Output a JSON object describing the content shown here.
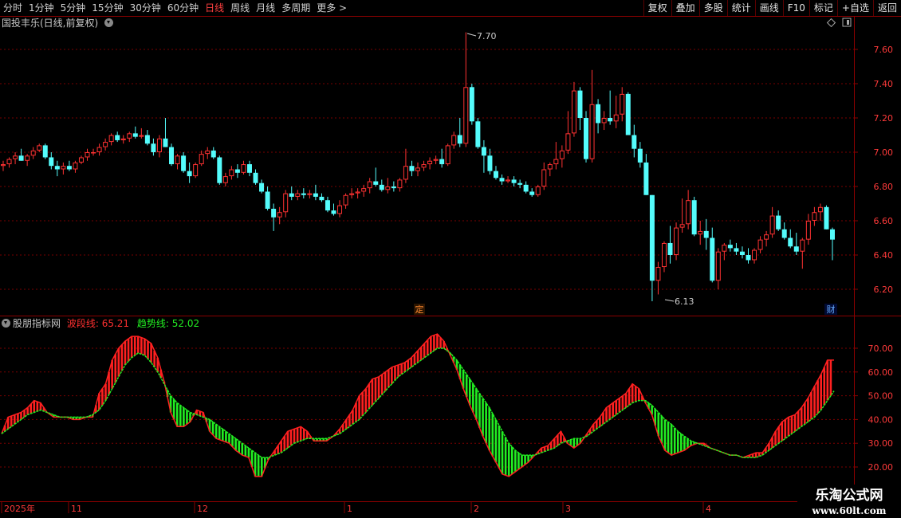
{
  "toolbar": {
    "periods": [
      {
        "label": "分时",
        "active": false
      },
      {
        "label": "1分钟",
        "active": false
      },
      {
        "label": "5分钟",
        "active": false
      },
      {
        "label": "15分钟",
        "active": false
      },
      {
        "label": "30分钟",
        "active": false
      },
      {
        "label": "60分钟",
        "active": false
      },
      {
        "label": "日线",
        "active": true
      },
      {
        "label": "周线",
        "active": false
      },
      {
        "label": "月线",
        "active": false
      },
      {
        "label": "多周期",
        "active": false
      },
      {
        "label": "更多 >",
        "active": false
      }
    ],
    "right_buttons": [
      "复权",
      "叠加",
      "多股",
      "统计",
      "画线",
      "F10",
      "标记",
      "+自选",
      "返回"
    ]
  },
  "main_panel": {
    "title": "国投丰乐(日线,前复权)",
    "high_label": "7.70",
    "low_label": "6.13",
    "y_ticks": [
      "7.60",
      "7.40",
      "7.20",
      "7.00",
      "6.80",
      "6.60",
      "6.40",
      "6.20"
    ],
    "marker_ding": "定",
    "marker_cai": "财"
  },
  "indicator_panel": {
    "name": "股朋指标网",
    "wave_label": "波段线: 65.21",
    "trend_label": "趋势线: 52.02",
    "y_ticks": [
      "70.00",
      "60.00",
      "50.00",
      "40.00",
      "30.00",
      "20.00"
    ]
  },
  "date_axis": {
    "labels": [
      "2025年",
      "11",
      "12",
      "1",
      "2",
      "3",
      "4"
    ]
  },
  "watermark": {
    "line1": "乐淘公式网",
    "line2": "www.60lt.com"
  },
  "colors": {
    "up": "#ff3232",
    "down": "#54fcfc",
    "wave": "#ff2020",
    "trend": "#22ee22",
    "grid": "#7a0000"
  },
  "chart_data": {
    "type": "candlestick",
    "price_range": [
      6.1,
      7.8
    ],
    "candles_ohlc": [
      [
        6.92,
        6.95,
        6.89,
        6.93
      ],
      [
        6.93,
        6.97,
        6.91,
        6.96
      ],
      [
        6.96,
        7.0,
        6.93,
        6.98
      ],
      [
        6.98,
        7.02,
        6.95,
        6.95
      ],
      [
        6.95,
        6.99,
        6.92,
        6.98
      ],
      [
        6.98,
        7.03,
        6.96,
        7.01
      ],
      [
        7.01,
        7.05,
        7.0,
        7.04
      ],
      [
        7.04,
        7.05,
        6.96,
        6.97
      ],
      [
        6.97,
        7.0,
        6.9,
        6.92
      ],
      [
        6.92,
        6.95,
        6.86,
        6.9
      ],
      [
        6.9,
        6.94,
        6.87,
        6.92
      ],
      [
        6.92,
        6.95,
        6.89,
        6.9
      ],
      [
        6.9,
        6.95,
        6.88,
        6.94
      ],
      [
        6.94,
        6.98,
        6.93,
        6.97
      ],
      [
        6.97,
        7.02,
        6.95,
        7.0
      ],
      [
        7.0,
        7.02,
        6.98,
        7.0
      ],
      [
        7.0,
        7.05,
        6.98,
        7.03
      ],
      [
        7.03,
        7.08,
        7.01,
        7.06
      ],
      [
        7.06,
        7.11,
        7.04,
        7.1
      ],
      [
        7.1,
        7.12,
        7.06,
        7.07
      ],
      [
        7.07,
        7.1,
        7.05,
        7.08
      ],
      [
        7.08,
        7.12,
        7.06,
        7.11
      ],
      [
        7.11,
        7.15,
        7.08,
        7.09
      ],
      [
        7.09,
        7.14,
        7.08,
        7.1
      ],
      [
        7.1,
        7.13,
        7.04,
        7.05
      ],
      [
        7.05,
        7.08,
        6.98,
        7.0
      ],
      [
        7.0,
        7.1,
        6.97,
        7.08
      ],
      [
        7.08,
        7.2,
        7.04,
        7.03
      ],
      [
        7.03,
        7.05,
        6.92,
        6.93
      ],
      [
        6.93,
        6.99,
        6.9,
        6.98
      ],
      [
        6.98,
        7.0,
        6.88,
        6.89
      ],
      [
        6.89,
        6.94,
        6.82,
        6.86
      ],
      [
        6.86,
        6.94,
        6.85,
        6.93
      ],
      [
        6.93,
        7.01,
        6.92,
        6.99
      ],
      [
        6.99,
        7.03,
        6.96,
        7.01
      ],
      [
        7.01,
        7.03,
        6.96,
        6.97
      ],
      [
        6.97,
        6.98,
        6.81,
        6.82
      ],
      [
        6.82,
        6.88,
        6.8,
        6.86
      ],
      [
        6.86,
        6.92,
        6.84,
        6.9
      ],
      [
        6.9,
        6.93,
        6.85,
        6.88
      ],
      [
        6.88,
        6.95,
        6.87,
        6.93
      ],
      [
        6.93,
        6.95,
        6.86,
        6.88
      ],
      [
        6.88,
        6.9,
        6.81,
        6.82
      ],
      [
        6.82,
        6.84,
        6.76,
        6.77
      ],
      [
        6.77,
        6.8,
        6.66,
        6.67
      ],
      [
        6.67,
        6.7,
        6.54,
        6.62
      ],
      [
        6.62,
        6.68,
        6.58,
        6.65
      ],
      [
        6.65,
        6.78,
        6.62,
        6.76
      ],
      [
        6.76,
        6.8,
        6.72,
        6.74
      ],
      [
        6.74,
        6.78,
        6.72,
        6.76
      ],
      [
        6.76,
        6.79,
        6.73,
        6.75
      ],
      [
        6.75,
        6.78,
        6.73,
        6.76
      ],
      [
        6.76,
        6.81,
        6.72,
        6.74
      ],
      [
        6.74,
        6.76,
        6.71,
        6.72
      ],
      [
        6.72,
        6.74,
        6.65,
        6.66
      ],
      [
        6.66,
        6.7,
        6.63,
        6.64
      ],
      [
        6.64,
        6.72,
        6.62,
        6.69
      ],
      [
        6.69,
        6.76,
        6.67,
        6.75
      ],
      [
        6.75,
        6.79,
        6.73,
        6.76
      ],
      [
        6.76,
        6.79,
        6.73,
        6.77
      ],
      [
        6.77,
        6.81,
        6.74,
        6.79
      ],
      [
        6.79,
        6.85,
        6.76,
        6.83
      ],
      [
        6.83,
        6.91,
        6.8,
        6.81
      ],
      [
        6.81,
        6.84,
        6.77,
        6.78
      ],
      [
        6.78,
        6.85,
        6.76,
        6.8
      ],
      [
        6.8,
        6.83,
        6.77,
        6.79
      ],
      [
        6.79,
        6.85,
        6.77,
        6.84
      ],
      [
        6.84,
        7.02,
        6.82,
        6.92
      ],
      [
        6.92,
        6.95,
        6.86,
        6.89
      ],
      [
        6.89,
        6.94,
        6.86,
        6.91
      ],
      [
        6.91,
        6.95,
        6.89,
        6.93
      ],
      [
        6.93,
        6.97,
        6.9,
        6.95
      ],
      [
        6.95,
        6.98,
        6.93,
        6.96
      ],
      [
        6.96,
        7.02,
        6.91,
        6.93
      ],
      [
        6.93,
        7.05,
        6.92,
        7.04
      ],
      [
        7.04,
        7.12,
        7.02,
        7.1
      ],
      [
        7.1,
        7.2,
        7.03,
        7.05
      ],
      [
        7.05,
        7.7,
        7.03,
        7.38
      ],
      [
        7.38,
        7.4,
        7.16,
        7.18
      ],
      [
        7.18,
        7.2,
        7.02,
        7.03
      ],
      [
        7.03,
        7.07,
        6.88,
        6.98
      ],
      [
        6.98,
        7.02,
        6.87,
        6.89
      ],
      [
        6.89,
        6.92,
        6.84,
        6.85
      ],
      [
        6.85,
        6.87,
        6.81,
        6.83
      ],
      [
        6.83,
        6.86,
        6.82,
        6.84
      ],
      [
        6.84,
        6.86,
        6.8,
        6.82
      ],
      [
        6.82,
        6.84,
        6.79,
        6.81
      ],
      [
        6.81,
        6.83,
        6.76,
        6.77
      ],
      [
        6.77,
        6.79,
        6.74,
        6.75
      ],
      [
        6.75,
        6.81,
        6.74,
        6.8
      ],
      [
        6.8,
        6.94,
        6.78,
        6.9
      ],
      [
        6.9,
        6.94,
        6.86,
        6.93
      ],
      [
        6.93,
        7.06,
        6.9,
        6.96
      ],
      [
        6.96,
        7.04,
        6.91,
        7.01
      ],
      [
        7.01,
        7.24,
        6.99,
        7.11
      ],
      [
        7.11,
        7.41,
        7.09,
        7.36
      ],
      [
        7.36,
        7.38,
        7.13,
        7.2
      ],
      [
        7.2,
        7.24,
        6.94,
        6.96
      ],
      [
        6.96,
        7.48,
        6.94,
        7.28
      ],
      [
        7.28,
        7.31,
        7.11,
        7.17
      ],
      [
        7.17,
        7.24,
        7.13,
        7.2
      ],
      [
        7.2,
        7.36,
        7.16,
        7.18
      ],
      [
        7.18,
        7.33,
        7.14,
        7.22
      ],
      [
        7.22,
        7.38,
        7.18,
        7.34
      ],
      [
        7.34,
        7.35,
        7.13,
        7.1
      ],
      [
        7.1,
        7.16,
        6.97,
        7.02
      ],
      [
        7.02,
        7.06,
        6.91,
        6.94
      ],
      [
        6.94,
        6.99,
        6.75,
        6.75
      ],
      [
        6.75,
        6.63,
        6.13,
        6.25
      ],
      [
        6.25,
        6.36,
        6.17,
        6.33
      ],
      [
        6.33,
        6.48,
        6.3,
        6.47
      ],
      [
        6.47,
        6.57,
        6.35,
        6.4
      ],
      [
        6.4,
        6.59,
        6.37,
        6.56
      ],
      [
        6.56,
        6.73,
        6.53,
        6.58
      ],
      [
        6.58,
        6.78,
        6.55,
        6.72
      ],
      [
        6.72,
        6.74,
        6.51,
        6.52
      ],
      [
        6.52,
        6.6,
        6.46,
        6.54
      ],
      [
        6.54,
        6.61,
        6.43,
        6.5
      ],
      [
        6.5,
        6.56,
        6.24,
        6.25
      ],
      [
        6.25,
        6.44,
        6.2,
        6.42
      ],
      [
        6.42,
        6.47,
        6.37,
        6.46
      ],
      [
        6.46,
        6.49,
        6.42,
        6.44
      ],
      [
        6.44,
        6.47,
        6.4,
        6.42
      ],
      [
        6.42,
        6.45,
        6.38,
        6.4
      ],
      [
        6.4,
        6.44,
        6.35,
        6.37
      ],
      [
        6.37,
        6.44,
        6.35,
        6.43
      ],
      [
        6.43,
        6.51,
        6.41,
        6.49
      ],
      [
        6.49,
        6.54,
        6.45,
        6.52
      ],
      [
        6.52,
        6.68,
        6.5,
        6.63
      ],
      [
        6.63,
        6.66,
        6.54,
        6.55
      ],
      [
        6.55,
        6.59,
        6.49,
        6.5
      ],
      [
        6.5,
        6.55,
        6.44,
        6.45
      ],
      [
        6.45,
        6.53,
        6.4,
        6.42
      ],
      [
        6.42,
        6.5,
        6.32,
        6.49
      ],
      [
        6.49,
        6.64,
        6.46,
        6.6
      ],
      [
        6.6,
        6.68,
        6.57,
        6.65
      ],
      [
        6.65,
        6.7,
        6.6,
        6.68
      ],
      [
        6.68,
        6.69,
        6.56,
        6.55
      ],
      [
        6.55,
        6.56,
        6.37,
        6.49
      ]
    ],
    "indicator": {
      "wave_values": [
        34,
        41,
        42,
        43,
        45,
        48,
        47,
        43,
        41,
        41,
        41,
        40,
        40,
        41,
        41,
        51,
        55,
        65,
        70,
        73,
        75,
        75,
        74,
        72,
        66,
        56,
        43,
        37,
        37,
        39,
        44,
        43,
        35,
        32,
        31,
        30,
        27,
        25,
        24,
        16,
        16,
        23,
        27,
        31,
        35,
        36,
        37,
        35,
        31,
        31,
        31,
        33,
        36,
        40,
        44,
        50,
        53,
        57,
        58,
        60,
        62,
        63,
        64,
        66,
        69,
        72,
        75,
        76,
        73,
        67,
        61,
        53,
        46,
        40,
        33,
        27,
        22,
        17,
        16,
        18,
        20,
        22,
        25,
        28,
        29,
        32,
        35,
        30,
        28,
        30,
        34,
        38,
        41,
        45,
        47,
        49,
        51,
        55,
        53,
        47,
        42,
        33,
        27,
        25,
        26,
        27,
        29,
        30,
        30,
        28,
        27,
        26,
        25,
        25,
        24,
        25,
        26,
        26,
        30,
        35,
        39,
        41,
        42,
        45,
        49,
        54,
        59,
        65,
        65
      ],
      "trend_values": [
        34,
        36,
        38,
        40,
        42,
        43,
        44,
        43,
        42,
        41,
        41,
        41,
        41,
        41,
        42,
        44,
        48,
        53,
        58,
        63,
        66,
        68,
        67,
        64,
        60,
        55,
        50,
        47,
        45,
        43,
        42,
        41,
        40,
        38,
        36,
        34,
        32,
        30,
        28,
        26,
        24,
        24,
        25,
        26,
        28,
        30,
        31,
        32,
        32,
        32,
        32,
        33,
        34,
        36,
        38,
        40,
        43,
        46,
        49,
        52,
        55,
        58,
        60,
        62,
        64,
        66,
        68,
        70,
        70,
        68,
        65,
        61,
        57,
        53,
        49,
        45,
        40,
        35,
        30,
        27,
        25,
        25,
        25,
        26,
        27,
        28,
        30,
        31,
        32,
        32,
        33,
        35,
        37,
        39,
        41,
        43,
        45,
        47,
        48,
        48,
        46,
        43,
        40,
        38,
        35,
        33,
        31,
        30,
        29,
        28,
        27,
        26,
        25,
        25,
        24,
        24,
        24,
        25,
        27,
        29,
        31,
        33,
        35,
        37,
        39,
        41,
        44,
        48,
        52
      ]
    }
  }
}
